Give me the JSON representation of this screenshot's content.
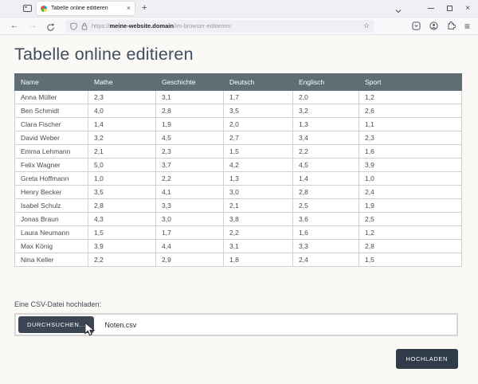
{
  "browser": {
    "tab_title": "Tabelle online editieren",
    "url": {
      "scheme": "https://",
      "domain": "meine-website.domain",
      "path": "/im-browser-editieren/"
    },
    "glyphs": {
      "close_tab": "×",
      "new_tab": "+",
      "back": "←",
      "forward": "→",
      "star": "☆",
      "menu": "≡",
      "window_close": "×"
    }
  },
  "page": {
    "title": "Tabelle online editieren",
    "table": {
      "columns": [
        "Name",
        "Mathe",
        "Geschichte",
        "Deutsch",
        "Englisch",
        "Sport"
      ],
      "rows": [
        [
          "Anna Müller",
          "2,3",
          "3,1",
          "1,7",
          "2,0",
          "1,2"
        ],
        [
          "Ben Schmidt",
          "4,0",
          "2,8",
          "3,5",
          "3,2",
          "2,6"
        ],
        [
          "Clara Fischer",
          "1,4",
          "1,9",
          "2,0",
          "1,3",
          "1,1"
        ],
        [
          "David Weber",
          "3,2",
          "4,5",
          "2,7",
          "3,4",
          "2,3"
        ],
        [
          "Emma Lehmann",
          "2,1",
          "2,3",
          "1,5",
          "2,2",
          "1,6"
        ],
        [
          "Felix Wagner",
          "5,0",
          "3,7",
          "4,2",
          "4,5",
          "3,9"
        ],
        [
          "Greta Hoffmann",
          "1,0",
          "2,2",
          "1,3",
          "1,4",
          "1,0"
        ],
        [
          "Henry Becker",
          "3,5",
          "4,1",
          "3,0",
          "2,8",
          "2,4"
        ],
        [
          "Isabel Schulz",
          "2,8",
          "3,3",
          "2,1",
          "2,5",
          "1,9"
        ],
        [
          "Jonas Braun",
          "4,3",
          "3,0",
          "3,8",
          "3,6",
          "2,5"
        ],
        [
          "Laura Neumann",
          "1,5",
          "1,7",
          "2,2",
          "1,6",
          "1,2"
        ],
        [
          "Max König",
          "3,9",
          "4,4",
          "3,1",
          "3,3",
          "2,8"
        ],
        [
          "Nina Keller",
          "2,2",
          "2,9",
          "1,8",
          "2,4",
          "1,5"
        ]
      ]
    },
    "upload": {
      "label": "Eine CSV-Datei hochladen:",
      "browse_button": "DURCHSUCHEN...",
      "filename": "Noten.csv",
      "submit_button": "HOCHLADEN"
    }
  },
  "colors": {
    "table_header_bg": "#5e6e74",
    "dark_button": "#3a4653",
    "submit_button": "#303c4a",
    "page_title": "#3e4d5f"
  }
}
